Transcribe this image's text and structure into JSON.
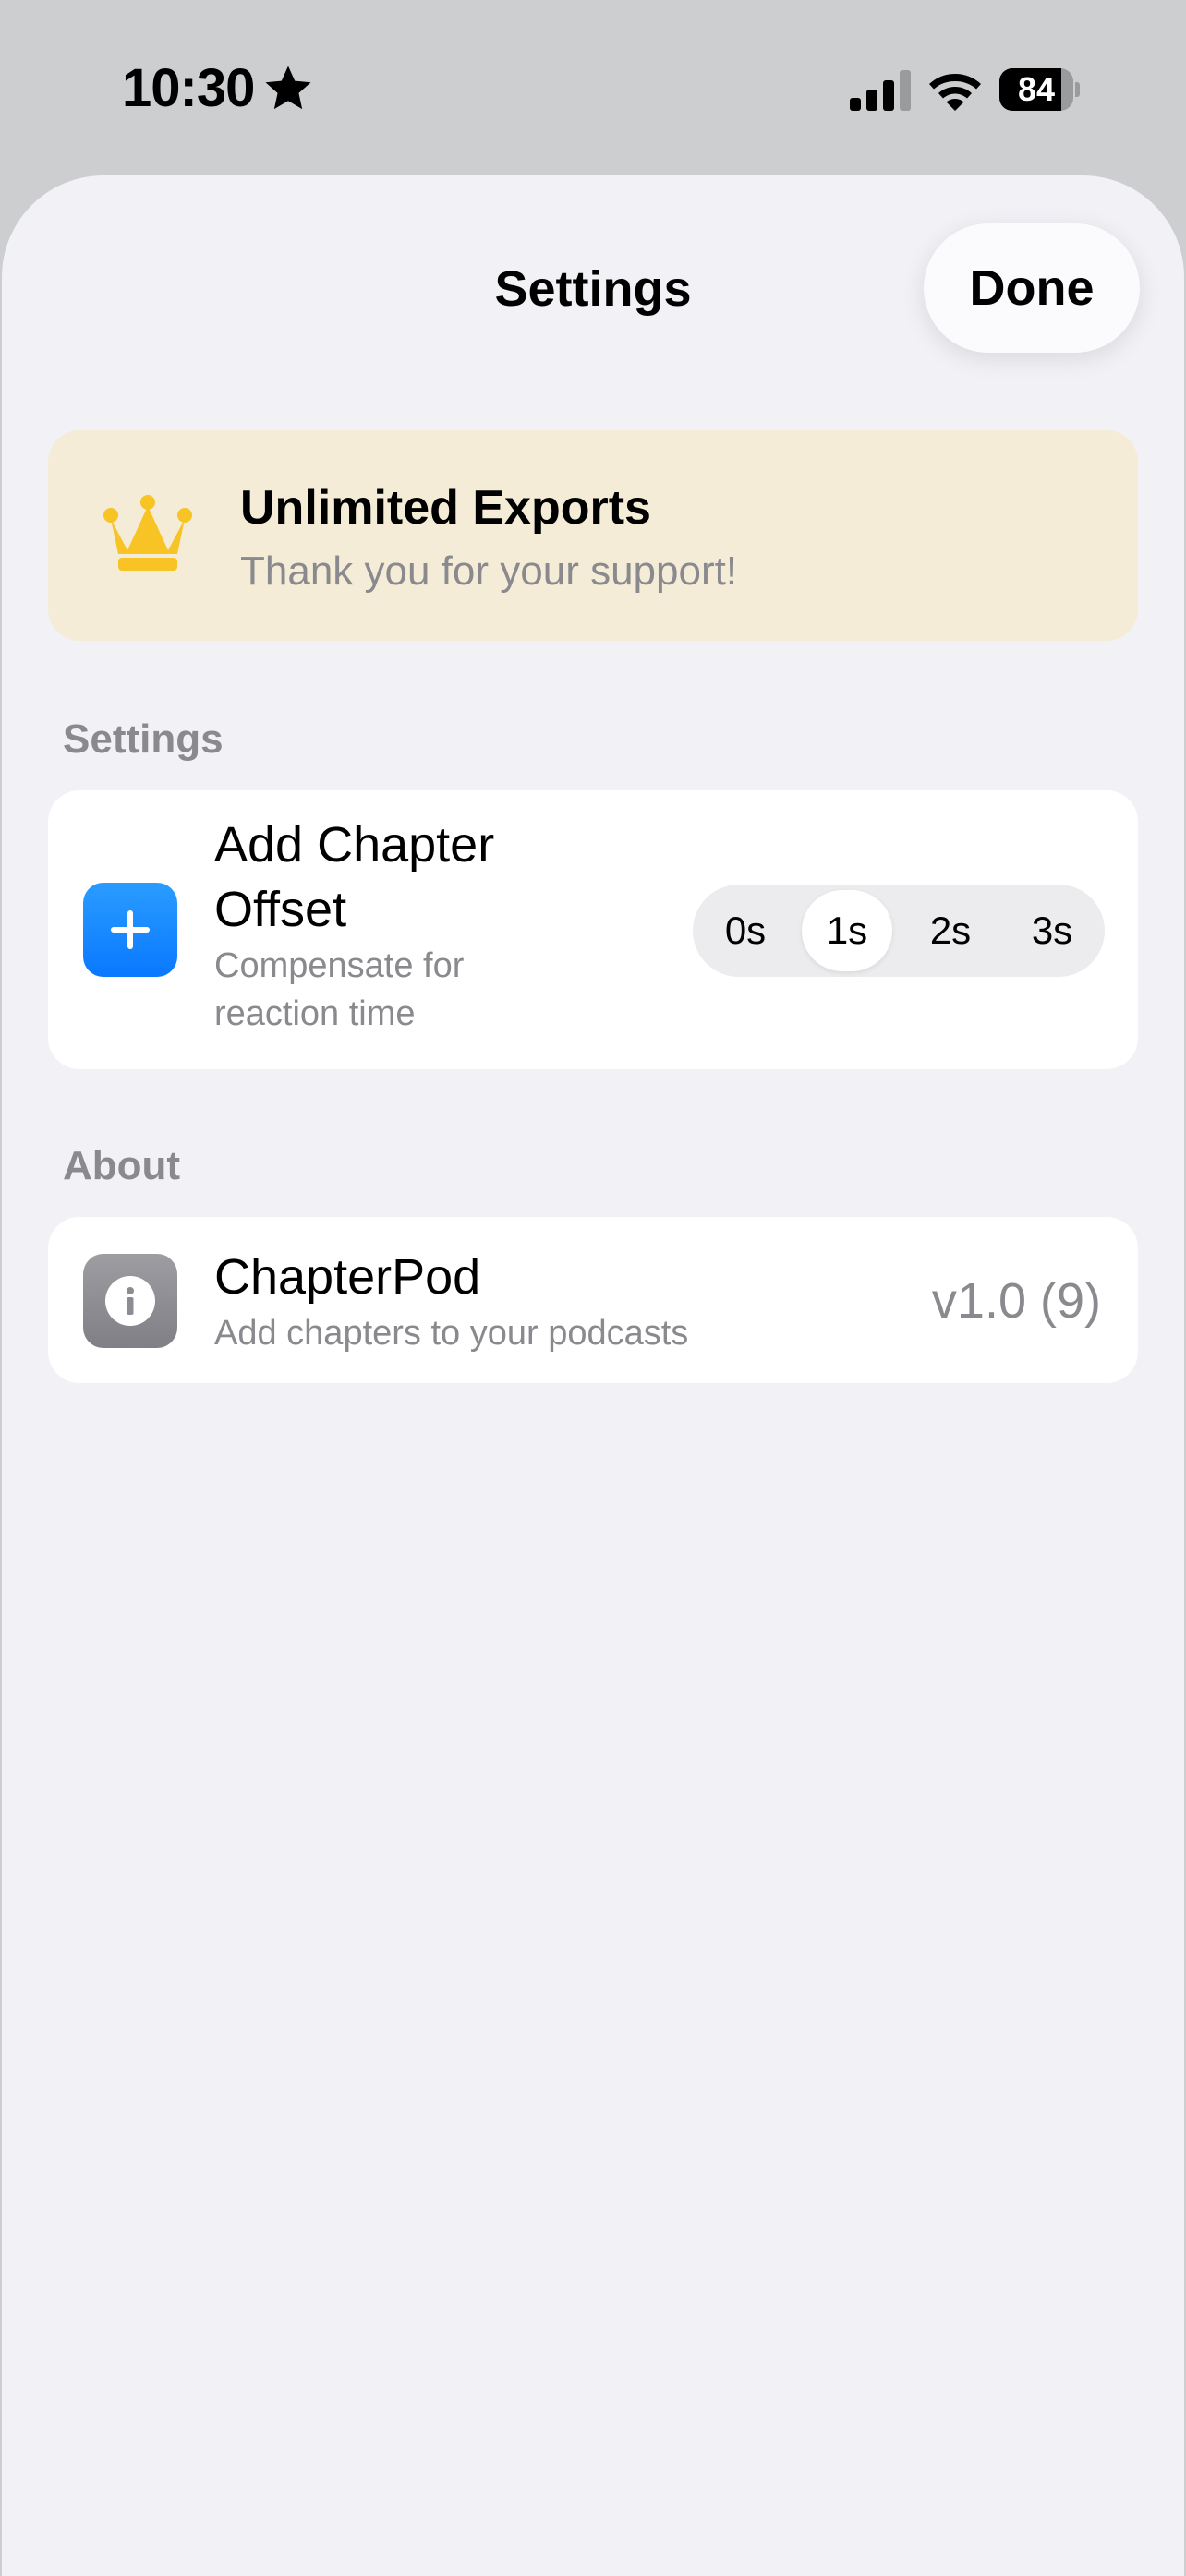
{
  "status_bar": {
    "time": "10:30",
    "battery_level": 84,
    "battery_label": "84"
  },
  "sheet": {
    "title": "Settings",
    "done_label": "Done"
  },
  "promo": {
    "icon": "crown-icon",
    "title": "Unlimited Exports",
    "subtitle": "Thank you for your support!",
    "color": "#f4ecd6"
  },
  "settings_section": {
    "header": "Settings",
    "chapter_offset": {
      "icon": "plus-icon",
      "title_line1": "Add Chapter",
      "title_line2": "Offset",
      "subtitle_line1": "Compensate for",
      "subtitle_line2": "reaction time",
      "options": [
        "0s",
        "1s",
        "2s",
        "3s"
      ],
      "selected": "1s"
    }
  },
  "about_section": {
    "header": "About",
    "app": {
      "icon": "info-icon",
      "name": "ChapterPod",
      "description": "Add chapters to your podcasts",
      "version": "v1.0 (9)"
    }
  },
  "colors": {
    "accent": "#0a78ff",
    "secondary_text": "#8a8a8e",
    "sheet_background": "#f1f1f6"
  }
}
